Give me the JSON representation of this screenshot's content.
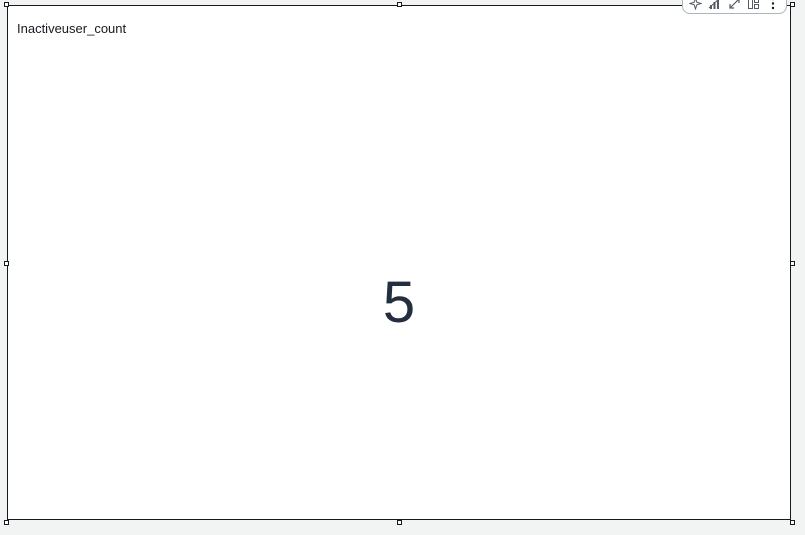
{
  "visual": {
    "title": "Inactiveuser_count",
    "value": "5"
  },
  "toolbar": {
    "icons": [
      "sparkle-icon",
      "bar-chart-icon",
      "expand-icon",
      "layout-icon",
      "more-options-icon"
    ]
  },
  "colors": {
    "border": "#16191f",
    "background": "#f2f3f3",
    "kpi_text": "#232f3e"
  }
}
